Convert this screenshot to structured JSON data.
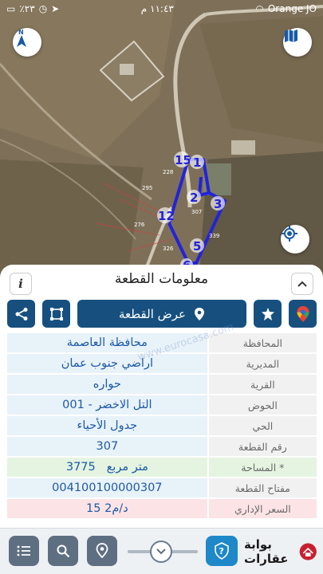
{
  "status_bar": {
    "battery": "٪٢٣",
    "time": "١١:٤٣ م",
    "carrier": "Orange JO"
  },
  "map": {
    "markers": [
      "15",
      "1",
      "2",
      "3",
      "12",
      "5",
      "6"
    ],
    "parcel_numbers": [
      "228",
      "295",
      "307",
      "276",
      "339",
      "326"
    ]
  },
  "sheet": {
    "title": "معلومات القطعة",
    "show_button_label": "عرض القطعة",
    "rows": [
      {
        "label": "المحافظة",
        "value": "محافظة العاصمة"
      },
      {
        "label": "المديرية",
        "value": "اراضي جنوب عمان"
      },
      {
        "label": "القرية",
        "value": "حواره"
      },
      {
        "label": "الحوض",
        "value": "التل الاخضر - 001"
      },
      {
        "label": "الحي",
        "value": "جدول الأحياء"
      },
      {
        "label": "رقم القطعة",
        "value": "307"
      },
      {
        "label": "المساحة *",
        "value": "3775   متر مربع"
      },
      {
        "label": "مفتاح القطعة",
        "value": "004100100000307"
      },
      {
        "label": "السعر الإداري",
        "value": "15 د/م2"
      }
    ]
  },
  "watermark": "www.eurocasa.com",
  "logo": {
    "text": "بوابة عقارات"
  },
  "colors": {
    "primary": "#17507f",
    "value_text": "#1d5aa8",
    "parcel_outline": "#2323d8",
    "help": "#1e88c9"
  }
}
